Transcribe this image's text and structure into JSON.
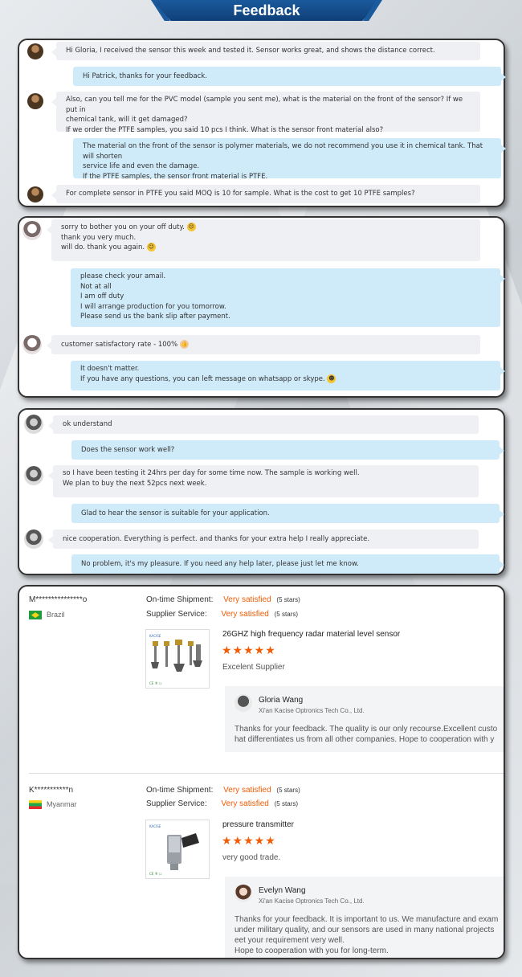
{
  "header": {
    "title": "Feedback"
  },
  "chat1": [
    {
      "side": "in",
      "text": "Hi Gloria, I received the sensor this week and tested it. Sensor works great, and shows the distance correct."
    },
    {
      "side": "out",
      "text": "Hi Patrick, thanks for your feedback."
    },
    {
      "side": "in",
      "lines": [
        "Also, can you tell me for the PVC model (sample you sent me), what is the material on the front of the sensor?  If we put in",
        "chemical tank, will it get damaged?",
        "If we order the PTFE samples,  you said 10 pcs I think. What is the sensor front material also?"
      ]
    },
    {
      "side": "out",
      "lines": [
        "The material on the front of the sensor is polymer materials, we do not recommend you use it in chemical tank. That will shorten",
        "service life and even the damage.",
        "If the PTFE samples, the sensor front material is PTFE."
      ]
    },
    {
      "side": "in",
      "text": "For complete sensor in PTFE you said MOQ is 10 for sample.  What is the cost to get 10 PTFE samples?"
    }
  ],
  "chat2": [
    {
      "side": "in",
      "lines": [
        "sorry to bother you on your off duty.",
        "thank you very much.",
        "will do. thank you again."
      ]
    },
    {
      "side": "out",
      "lines": [
        "please check your amail.",
        "Not at all",
        "I am off duty",
        "I will arrange production for you tomorrow.",
        "Please send us the bank slip after payment."
      ]
    },
    {
      "side": "in",
      "text": "customer satisfactory rate - 100%"
    },
    {
      "side": "out",
      "lines": [
        "It doesn't matter.",
        "If you have any questions, you can left message on whatsapp or skype."
      ]
    }
  ],
  "chat3": [
    {
      "side": "in",
      "text": "ok understand"
    },
    {
      "side": "out",
      "text": "Does the sensor work well?"
    },
    {
      "side": "in",
      "lines": [
        "so I have been testing it 24hrs per day for some time now. The sample is working well.",
        "We plan to buy the next 52pcs next week."
      ]
    },
    {
      "side": "out",
      "text": "Glad to hear the sensor is suitable for your application."
    },
    {
      "side": "in",
      "text": "nice cooperation. Everything is perfect. and thanks for your extra help I really appreciate."
    },
    {
      "side": "out",
      "text": "No problem, it's my pleasure. If you need any help later, please just let me know."
    }
  ],
  "reviews": [
    {
      "buyer": "M***************o",
      "country": "Brazil",
      "shipment_label": "On-time Shipment:",
      "shipment_value": "Very satisfied",
      "shipment_stars": "(5 stars)",
      "service_label": "Supplier Service:",
      "service_value": "Very satisfied",
      "service_stars": "(5 stars)",
      "product": "26GHZ high frequency radar material level sensor",
      "rating": 5,
      "comment": "Excelent Supplier",
      "reply_name": "Gloria Wang",
      "reply_company": "Xi'an Kacise Optronics Tech Co., Ltd.",
      "reply_text": "Thanks for your feedback. The quality is our only recourse.Excellent custo\nhat differentiates us from all other companies. Hope to cooperation with y"
    },
    {
      "buyer": "K***********n",
      "country": "Myanmar",
      "shipment_label": "On-time Shipment:",
      "shipment_value": "Very satisfied",
      "shipment_stars": "(5 stars)",
      "service_label": "Supplier Service:",
      "service_value": "Very satisfied",
      "service_stars": "(5 stars)",
      "product": "pressure transmitter",
      "rating": 5,
      "comment": "very good trade.",
      "reply_name": "Evelyn Wang",
      "reply_company": "Xi'an Kacise Optronics Tech Co., Ltd.",
      "reply_text": "Thanks for your feedback. It is important to us. We manufacture and exam\nunder military quality, and our sensors are used in many national projects\neet your requirement very well.\nHope to cooperation with you for long-term."
    }
  ],
  "stars_glyph": "★★★★★",
  "product_brand": "KACISE",
  "product_marks": "CE ® ☐"
}
